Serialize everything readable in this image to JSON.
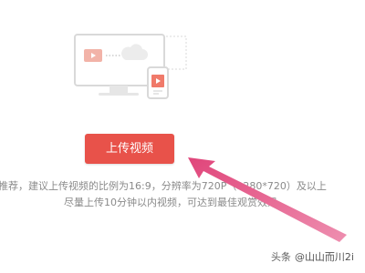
{
  "upload": {
    "button_label": "上传视频"
  },
  "tips": {
    "line1": "推荐，建议上传视频的比例为16:9，分辨率为720P（1280*720）及以上",
    "line2": "尽量上传10分钟以内视频，可达到最佳观赏效果"
  },
  "watermark": {
    "source": "头条",
    "handle": "@山山而川2i"
  },
  "colors": {
    "button": "#e8524a",
    "arrow": "#e0457a",
    "illustration_accent": "#f07a6a",
    "illustration_line": "#d9d9d9"
  },
  "icons": {
    "illustration": "monitor-phone-upload-illustration",
    "arrow": "pointer-arrow"
  }
}
